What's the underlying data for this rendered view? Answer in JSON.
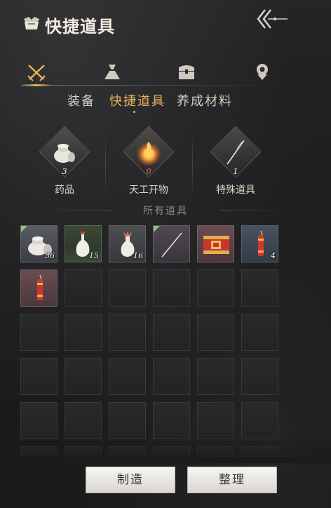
{
  "header": {
    "title": "快捷道具",
    "icon": "bundle-icon",
    "back_icon": "back-arrow-icon"
  },
  "category_tabs": [
    {
      "name": "equipment",
      "icon": "crossed-swords-icon",
      "active": true
    },
    {
      "name": "consumables",
      "icon": "sack-icon",
      "active": false
    },
    {
      "name": "chest",
      "icon": "chest-icon",
      "active": false
    },
    {
      "name": "badge",
      "icon": "badge-icon",
      "active": false
    }
  ],
  "sub_tabs": [
    {
      "label": "装备",
      "active": false
    },
    {
      "label": "快捷道具",
      "active": true
    },
    {
      "label": "养成材料",
      "active": false
    }
  ],
  "categories": [
    {
      "label": "药品",
      "count": "3",
      "icon": "medicine-jar-icon"
    },
    {
      "label": "天工开物",
      "count": "0",
      "icon": "flame-orb-icon"
    },
    {
      "label": "特殊道具",
      "count": "1",
      "icon": "needle-icon"
    }
  ],
  "section_heading": "所有道具",
  "items": [
    {
      "icon": "medicine-jar-icon",
      "qty": "36",
      "quality": "white",
      "tag": true
    },
    {
      "icon": "white-vase-icon",
      "qty": "15",
      "quality": "green",
      "tag": false
    },
    {
      "icon": "flower-vase-icon",
      "qty": "16",
      "quality": "grey",
      "tag": false
    },
    {
      "icon": "needle-icon",
      "qty": "",
      "quality": "purple",
      "tag": true
    },
    {
      "icon": "firecracker-box-icon",
      "qty": "",
      "quality": "red",
      "tag": false
    },
    {
      "icon": "firecracker-icon",
      "qty": "4",
      "quality": "blue",
      "tag": false
    },
    {
      "icon": "firecracker-icon",
      "qty": "",
      "quality": "red",
      "tag": false
    }
  ],
  "buttons": {
    "craft": "制造",
    "sort": "整理"
  },
  "colors": {
    "accent": "#e9b25b",
    "zero_count": "#e07a5a",
    "corner_tag": "#8fc48a"
  }
}
